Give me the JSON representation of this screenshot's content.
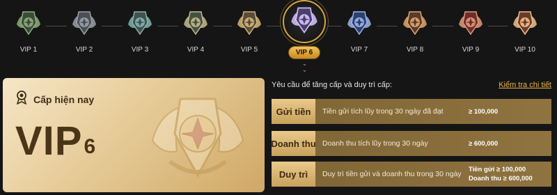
{
  "levels": [
    {
      "label": "VIP 1",
      "icon": "vip-1-badge-icon"
    },
    {
      "label": "VIP 2",
      "icon": "vip-2-badge-icon"
    },
    {
      "label": "VIP 3",
      "icon": "vip-3-badge-icon"
    },
    {
      "label": "VIP 4",
      "icon": "vip-4-badge-icon"
    },
    {
      "label": "VIP 5",
      "icon": "vip-5-badge-icon"
    },
    {
      "label": "VIP 6",
      "icon": "vip-6-badge-icon",
      "active": true
    },
    {
      "label": "VIP 7",
      "icon": "vip-7-badge-icon"
    },
    {
      "label": "VIP 8",
      "icon": "vip-8-badge-icon"
    },
    {
      "label": "VIP 9",
      "icon": "vip-9-badge-icon"
    },
    {
      "label": "VIP 10",
      "icon": "vip-10-badge-icon"
    }
  ],
  "current": {
    "title": "Cấp hiện nay",
    "vip_text": "VIP",
    "vip_number": "6"
  },
  "requirements": {
    "title": "Yêu cầu để tăng cấp và duy trì cấp:",
    "link": "Kiểm tra chi tiết",
    "rows": [
      {
        "label": "Gửi tiền",
        "desc": "Tiền gửi tích lũy trong 30 ngày đã đạt",
        "value1": "≥ 100,000",
        "value2": ""
      },
      {
        "label": "Doanh thu",
        "desc": "Doanh thu tích lũy trong 30 ngày",
        "value1": "≥ 600,000",
        "value2": ""
      },
      {
        "label": "Duy trì",
        "desc": "Duy trì tiền gửi và doanh thu trong 30 ngày",
        "value1": "Tiền gửi ≥ 100,000",
        "value2": "Doanh thu ≥ 600,000"
      }
    ]
  },
  "colors": {
    "accent": "#d6a442",
    "background": "#151515",
    "card": "#e6cb98"
  }
}
